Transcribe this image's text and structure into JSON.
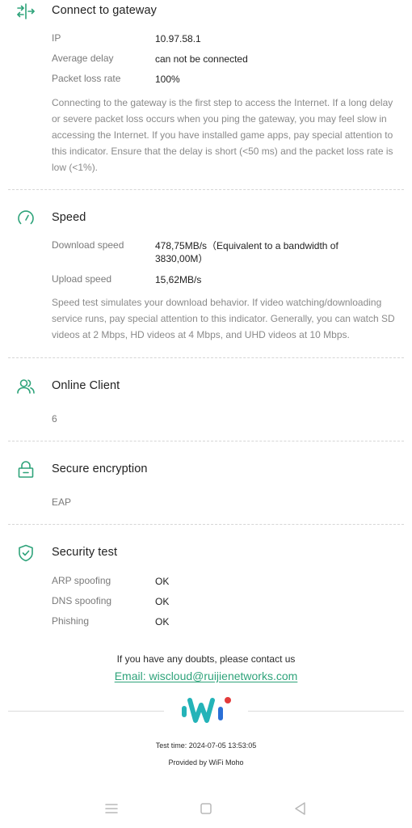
{
  "gateway": {
    "title": "Connect to gateway",
    "icon": "gateway-arrows-icon",
    "rows": [
      {
        "label": "IP",
        "value": "10.97.58.1"
      },
      {
        "label": "Average delay",
        "value": "can not be connected"
      },
      {
        "label": "Packet loss rate",
        "value": "100%"
      }
    ],
    "description": "Connecting to the gateway is the first step to access the Internet. If a long delay or severe packet loss occurs when you ping the gateway, you may feel slow in accessing the Internet. If you have installed game apps, pay special attention to this indicator. Ensure that the delay is short (<50 ms) and the packet loss rate is low (<1%)."
  },
  "speed": {
    "title": "Speed",
    "icon": "speedometer-icon",
    "rows": [
      {
        "label": "Download speed",
        "value": "478,75MB/s（Equivalent to a bandwidth of 3830,00M）"
      },
      {
        "label": "Upload speed",
        "value": "15,62MB/s"
      }
    ],
    "description": "Speed test simulates your download behavior. If video watching/downloading service runs, pay special attention to this indicator. Generally, you can watch SD videos at 2 Mbps, HD videos at 4 Mbps, and UHD videos at 10 Mbps."
  },
  "clients": {
    "title": "Online Client",
    "icon": "users-icon",
    "value": "6"
  },
  "encryption": {
    "title": "Secure encryption",
    "icon": "lock-icon",
    "value": "EAP"
  },
  "security": {
    "title": "Security test",
    "icon": "shield-check-icon",
    "rows": [
      {
        "label": "ARP spoofing",
        "value": "OK"
      },
      {
        "label": "DNS spoofing",
        "value": "OK"
      },
      {
        "label": "Phishing",
        "value": "OK"
      }
    ]
  },
  "footer": {
    "contact_text": "If you have any doubts, please contact us",
    "email_label": "Email: wiscloud@ruijienetworks.com",
    "test_time": "Test time: 2024-07-05 13:53:05",
    "provided_by": "Provided by WiFi Moho"
  },
  "colors": {
    "accent": "#2ea37a",
    "logo_teal": "#24b3b8",
    "logo_blue": "#2a6fd6",
    "logo_red": "#e33b3b"
  },
  "navbar": {
    "icons": [
      "menu-icon",
      "home-square-icon",
      "back-triangle-icon"
    ]
  }
}
